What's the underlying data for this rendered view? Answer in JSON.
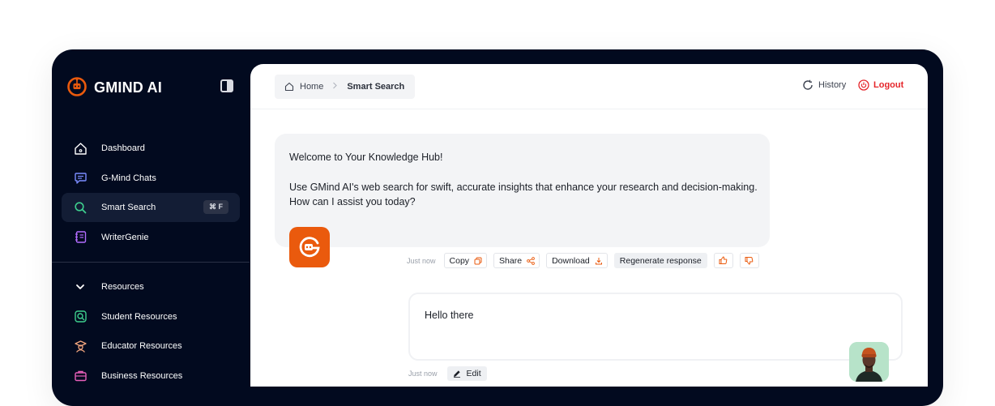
{
  "brand": {
    "name": "GMIND AI",
    "accent": "#ea5a0d"
  },
  "sidebar": {
    "items": [
      {
        "label": "Dashboard",
        "icon": "home-icon"
      },
      {
        "label": "G-Mind Chats",
        "icon": "chat-icon"
      },
      {
        "label": "Smart Search",
        "icon": "search-icon",
        "active": true,
        "shortcut": "⌘ F"
      },
      {
        "label": "WriterGenie",
        "icon": "notebook-icon"
      }
    ],
    "resources": {
      "label": "Resources",
      "items": [
        {
          "label": "Student Resources",
          "icon": "student-search-icon"
        },
        {
          "label": "Educator Resources",
          "icon": "educator-icon"
        },
        {
          "label": "Business Resources",
          "icon": "briefcase-icon"
        }
      ]
    }
  },
  "header": {
    "breadcrumb": {
      "home": "Home",
      "current": "Smart Search"
    },
    "history_label": "History",
    "logout_label": "Logout"
  },
  "chat": {
    "bot_message": {
      "line1": "Welcome to Your Knowledge Hub!",
      "line2": "Use GMind AI's web search for swift, accurate insights that enhance  your research and decision-making. How can I assist you today?",
      "time": "Just now",
      "actions": {
        "copy": "Copy",
        "share": "Share",
        "download": "Download",
        "regenerate": "Regenerate response"
      }
    },
    "user_message": {
      "text": "Hello there",
      "time": "Just now",
      "edit_label": "Edit"
    }
  }
}
